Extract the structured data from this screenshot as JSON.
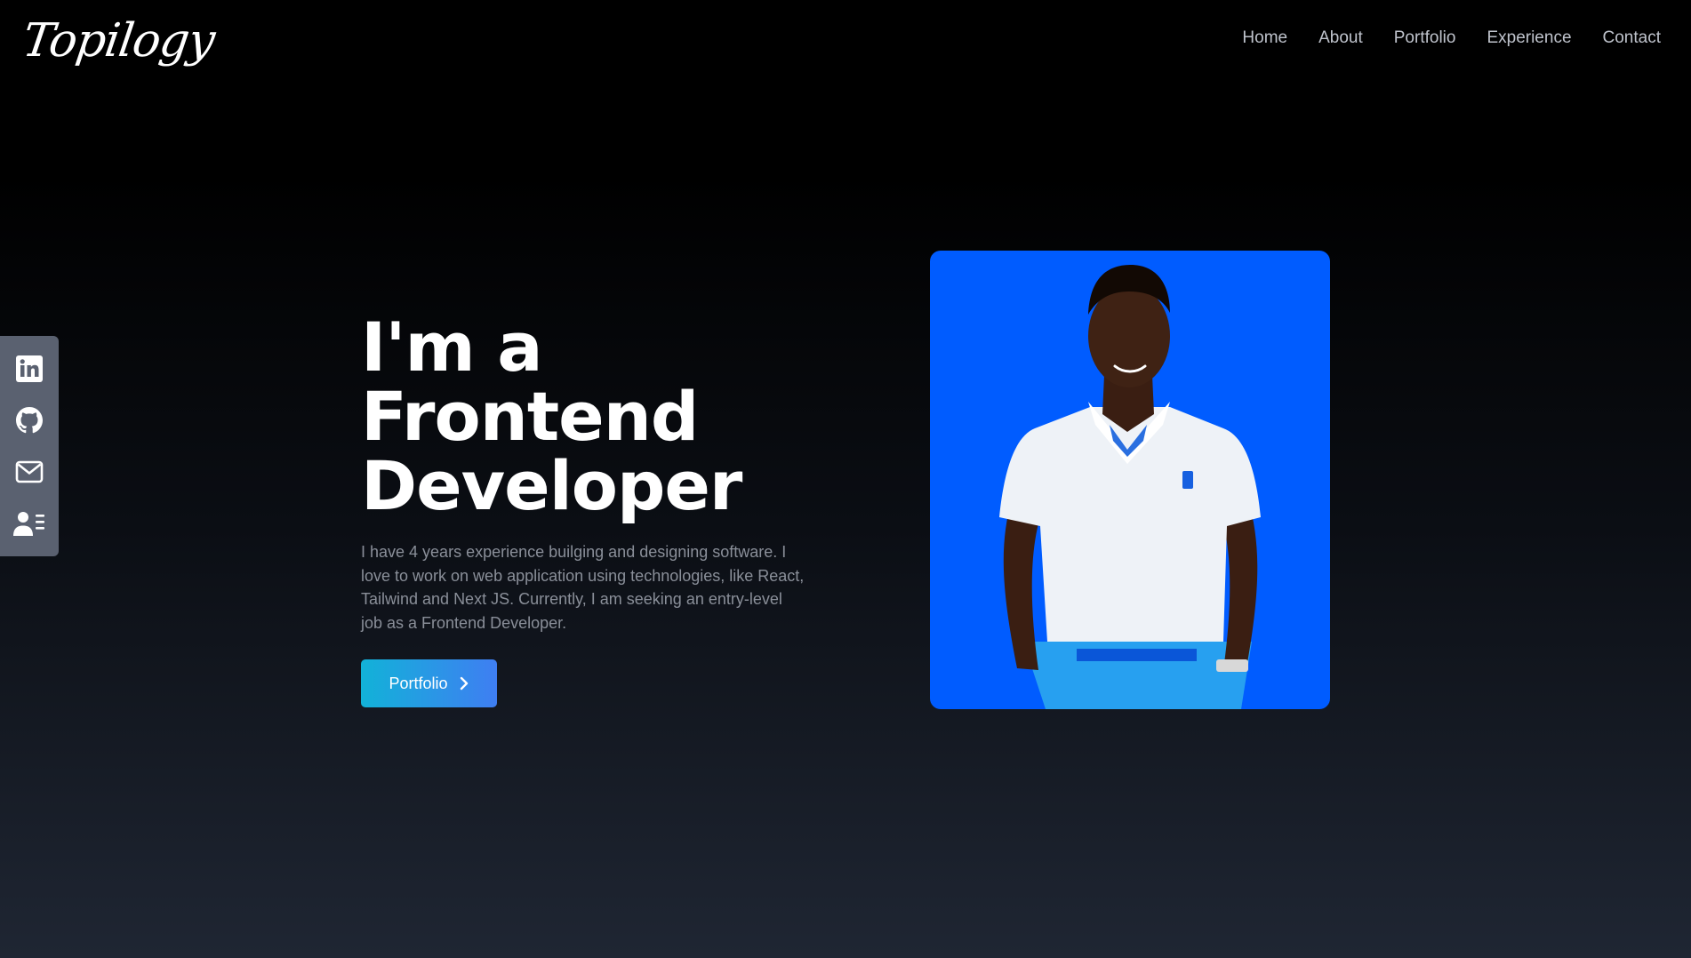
{
  "brand": {
    "logo_text": "Topilogy"
  },
  "nav": {
    "items": [
      {
        "label": "Home"
      },
      {
        "label": "About"
      },
      {
        "label": "Portfolio"
      },
      {
        "label": "Experience"
      },
      {
        "label": "Contact"
      }
    ]
  },
  "social": {
    "items": [
      {
        "icon": "linkedin-icon"
      },
      {
        "icon": "github-icon"
      },
      {
        "icon": "mail-icon"
      },
      {
        "icon": "resume-icon"
      }
    ]
  },
  "hero": {
    "title_line1": "I'm a Frontend",
    "title_line2": "Developer",
    "description": "I have 4 years experience builging and designing software. I love to work on web application using technologies, like React, Tailwind and Next JS. Currently, I am seeking an entry-level job as a Frontend Developer.",
    "button_label": "Portfolio"
  },
  "colors": {
    "background_top": "#000000",
    "background_bottom": "#1f2633",
    "button_gradient_start": "#12b2d8",
    "button_gradient_end": "#3f7ef2",
    "photo_background": "#005cff",
    "social_bar": "#5a6170"
  }
}
